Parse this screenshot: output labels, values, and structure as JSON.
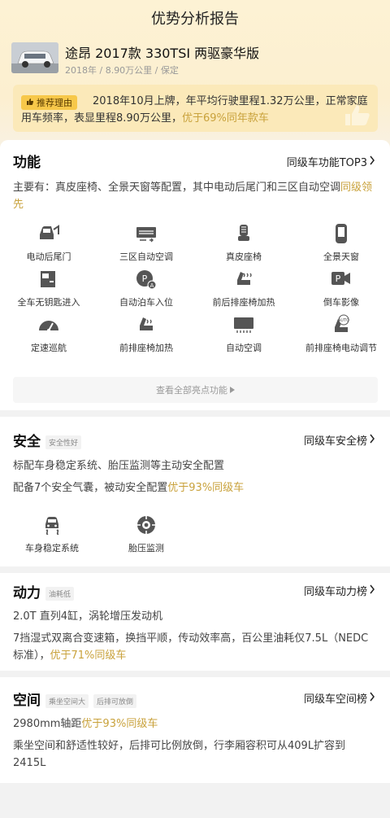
{
  "header": {
    "title": "优势分析报告"
  },
  "car": {
    "name": "途昂 2017款 330TSI 两驱豪华版",
    "meta": "2018年 / 8.90万公里 / 保定"
  },
  "recommend": {
    "badge": "推荐理由",
    "text": "2018年10月上牌，年平均行驶里程1.32万公里，正常家庭用车频率，表显里程8.90万公里，",
    "highlight": "优于69%同年款车"
  },
  "function": {
    "title": "功能",
    "link": "同级车功能TOP3",
    "desc": "主要有：真皮座椅、全景天窗等配置，其中电动后尾门和三区自动空调",
    "desc_highlight": "同级领先",
    "features": [
      {
        "label": "电动后尾门",
        "icon": "power-tailgate-icon"
      },
      {
        "label": "三区自动空调",
        "icon": "tri-zone-ac-icon"
      },
      {
        "label": "真皮座椅",
        "icon": "leather-seat-icon"
      },
      {
        "label": "全景天窗",
        "icon": "panoramic-sunroof-icon"
      },
      {
        "label": "全车无钥匙进入",
        "icon": "keyless-entry-icon"
      },
      {
        "label": "自动泊车入位",
        "icon": "auto-parking-icon"
      },
      {
        "label": "前后排座椅加热",
        "icon": "seat-heating-icon"
      },
      {
        "label": "倒车影像",
        "icon": "reverse-camera-icon"
      },
      {
        "label": "定速巡航",
        "icon": "cruise-control-icon"
      },
      {
        "label": "前排座椅加热",
        "icon": "front-seat-heating-icon"
      },
      {
        "label": "自动空调",
        "icon": "auto-ac-icon"
      },
      {
        "label": "前排座椅电动调节",
        "icon": "power-seat-icon"
      }
    ],
    "view_all": "查看全部亮点功能"
  },
  "safety": {
    "title": "安全",
    "tag": "安全性好",
    "link": "同级车安全榜",
    "line1": "标配车身稳定系统、胎压监测等主动安全配置",
    "line2": "配备7个安全气囊，被动安全配置",
    "line2_highlight": "优于93%同级车",
    "features": [
      {
        "label": "车身稳定系统",
        "icon": "stability-control-icon"
      },
      {
        "label": "胎压监测",
        "icon": "tire-pressure-icon"
      }
    ]
  },
  "power": {
    "title": "动力",
    "tag": "油耗低",
    "link": "同级车动力榜",
    "line1": "2.0T 直列4缸，涡轮增压发动机",
    "line2": "7挡湿式双离合变速箱，换挡平顺，传动效率高，百公里油耗仅7.5L（NEDC标准），",
    "line2_highlight": "优于71%同级车"
  },
  "space": {
    "title": "空间",
    "tag1": "乘坐空间大",
    "tag2": "后排可放倒",
    "link": "同级车空间榜",
    "line1": "2980mm轴距",
    "line1_highlight": "优于93%同级车",
    "line2": "乘坐空间和舒适性较好，后排可比例放倒，行李厢容积可从409L扩容到2415L"
  },
  "colors": {
    "accent": "#c9a23c",
    "badge": "#f7c84a"
  }
}
